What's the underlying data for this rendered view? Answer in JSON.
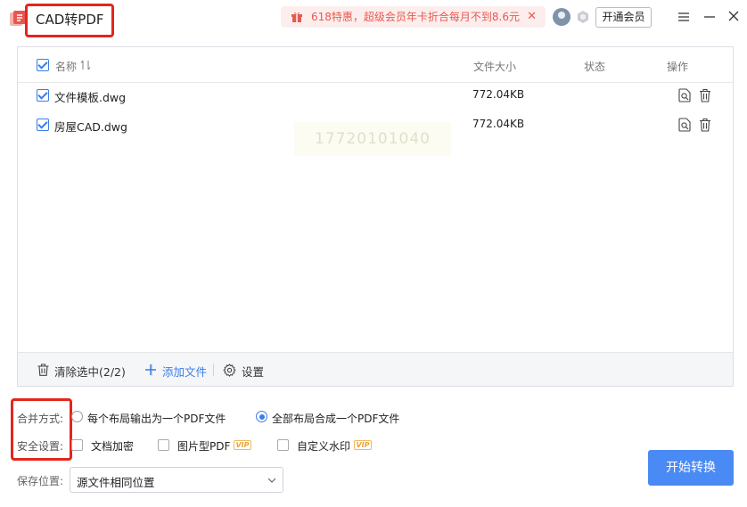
{
  "titlebar": {
    "app_title": "CAD转PDF",
    "promo_text": "618特惠，超级会员年卡折合每月不到8.6元",
    "member_button": "开通会员"
  },
  "file_list": {
    "columns": {
      "name": "名称",
      "size": "文件大小",
      "status": "状态",
      "action": "操作"
    },
    "rows": [
      {
        "name": "文件模板.dwg",
        "size": "772.04KB",
        "status": "",
        "checked": true
      },
      {
        "name": "房屋CAD.dwg",
        "size": "772.04KB",
        "status": "",
        "checked": true
      }
    ],
    "watermark": "17720101040"
  },
  "footer": {
    "clear_label": "清除选中(2/2)",
    "add_label": "添加文件",
    "settings_label": "设置"
  },
  "options": {
    "merge_label": "合并方式:",
    "merge_choices": [
      "每个布局输出为一个PDF文件",
      "全部布局合成一个PDF文件"
    ],
    "merge_selected": 1,
    "security_label": "安全设置:",
    "security_choices": [
      {
        "label": "文档加密",
        "vip": false
      },
      {
        "label": "图片型PDF",
        "vip": true
      },
      {
        "label": "自定义水印",
        "vip": true
      }
    ],
    "vip_tag": "VIP",
    "save_label": "保存位置:",
    "save_value": "源文件相同位置"
  },
  "start_button": "开始转换",
  "colors": {
    "accent": "#4a8af4",
    "highlight_box": "#e3261c",
    "promo_bg": "#fdeeee",
    "promo_text": "#e85a4f"
  }
}
